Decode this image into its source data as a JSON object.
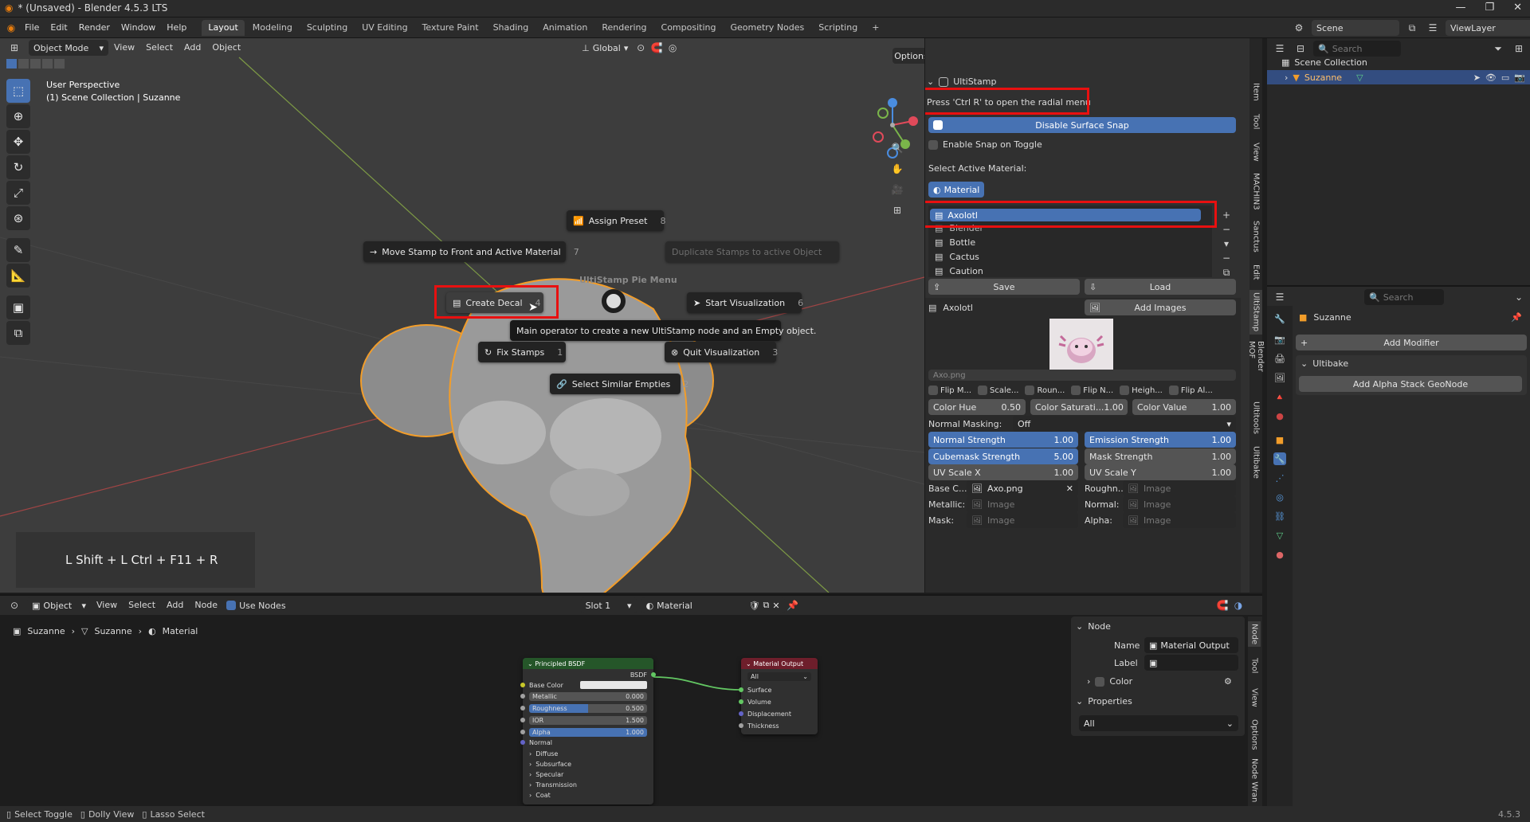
{
  "title": "* (Unsaved) - Blender 4.5.3 LTS",
  "menu": [
    "File",
    "Edit",
    "Render",
    "Window",
    "Help"
  ],
  "workspaces": [
    "Layout",
    "Modeling",
    "Sculpting",
    "UV Editing",
    "Texture Paint",
    "Shading",
    "Animation",
    "Rendering",
    "Compositing",
    "Geometry Nodes",
    "Scripting"
  ],
  "workspace_active": "Layout",
  "scene": "Scene",
  "view_layer": "ViewLayer",
  "viewport": {
    "mode": "Object Mode",
    "menus": [
      "View",
      "Select",
      "Add",
      "Object"
    ],
    "transform_orientation": "Global",
    "options_label": "Options",
    "overlay_line1": "User Perspective",
    "overlay_line2": "(1) Scene Collection | Suzanne",
    "shortcut_display": "L Shift + L Ctrl + F11 + R",
    "watermark": "UltiStamp Pie Menu",
    "tooltip": "Main operator to create a new UltiStamp node and an Empty object.",
    "pie": {
      "assign_preset": {
        "label": "Assign Preset",
        "num": "8"
      },
      "move_stamp": {
        "label": "Move Stamp to Front and Active Material",
        "num": "7"
      },
      "duplicate": {
        "label": "Duplicate Stamps to active Object",
        "num": ""
      },
      "create_decal": {
        "label": "Create Decal",
        "num": "4"
      },
      "start_vis": {
        "label": "Start Visualization",
        "num": "6"
      },
      "fix_stamps": {
        "label": "Fix Stamps",
        "num": "1"
      },
      "quit_vis": {
        "label": "Quit Visualization",
        "num": "3"
      },
      "select_similar": {
        "label": "Select Similar Empties",
        "num": "2"
      }
    }
  },
  "ultistamp": {
    "header": "UltiStamp",
    "hint": "Press 'Ctrl R' to open the radial menu",
    "disable_snap": "Disable Surface Snap",
    "enable_snap": "Enable Snap on Toggle",
    "select_material_label": "Select Active Material:",
    "material_btn": "Material",
    "stamps": [
      "Axolotl",
      "Blender",
      "Bottle",
      "Cactus",
      "Caution"
    ],
    "save": "Save",
    "load": "Load",
    "current": "Axolotl",
    "add_images": "Add Images",
    "image_name": "Axo.png",
    "flips": [
      "Flip M...",
      "Scale...",
      "Roun...",
      "Flip N...",
      "Heigh...",
      "Flip Al..."
    ],
    "color_hue": {
      "label": "Color Hue",
      "value": "0.50"
    },
    "color_sat": {
      "label": "Color Saturati...",
      "value": "1.00"
    },
    "color_val": {
      "label": "Color Value",
      "value": "1.00"
    },
    "normal_masking_label": "Normal Masking:",
    "normal_masking_value": "Off",
    "normal_strength": {
      "label": "Normal Strength",
      "value": "1.00"
    },
    "emission_strength": {
      "label": "Emission Strength",
      "value": "1.00"
    },
    "cubemask_strength": {
      "label": "Cubemask Strength",
      "value": "5.00"
    },
    "mask_strength": {
      "label": "Mask Strength",
      "value": "1.00"
    },
    "uv_scale_x": {
      "label": "UV Scale X",
      "value": "1.00"
    },
    "uv_scale_y": {
      "label": "UV Scale Y",
      "value": "1.00"
    },
    "base_color": {
      "label": "Base C...",
      "value": "Axo.png"
    },
    "roughness": {
      "label": "Roughn...",
      "value": "Image"
    },
    "metallic": {
      "label": "Metallic:",
      "value": "Image"
    },
    "normal": {
      "label": "Normal:",
      "value": "Image"
    },
    "mask": {
      "label": "Mask:",
      "value": "Image"
    },
    "alpha": {
      "label": "Alpha:",
      "value": "Image"
    }
  },
  "side_tabs": [
    "Item",
    "Tool",
    "View",
    "MACHIN3",
    "Sanctus",
    "Edit",
    "UltiStamp",
    "Blender MOF",
    "Ultitools",
    "Ultibake"
  ],
  "outliner": {
    "search": "Search",
    "collection": "Scene Collection",
    "object": "Suzanne"
  },
  "properties": {
    "search": "Search",
    "object": "Suzanne",
    "add_modifier": "Add Modifier",
    "ultibake": "Ultibake",
    "add_alpha": "Add Alpha Stack GeoNode"
  },
  "node_editor": {
    "type": "Object",
    "menus": [
      "View",
      "Select",
      "Add",
      "Node"
    ],
    "use_nodes": "Use Nodes",
    "slot": "Slot 1",
    "material": "Material",
    "breadcrumb": [
      "Suzanne",
      "Suzanne",
      "Material"
    ],
    "bsdf": {
      "title": "Principled BSDF",
      "out": "BSDF",
      "base_color": "Base Color",
      "metallic": {
        "label": "Metallic",
        "value": "0.000"
      },
      "roughness": {
        "label": "Roughness",
        "value": "0.500"
      },
      "ior": {
        "label": "IOR",
        "value": "1.500"
      },
      "alpha": {
        "label": "Alpha",
        "value": "1.000"
      },
      "normal": "Normal",
      "subs": [
        "Diffuse",
        "Subsurface",
        "Specular",
        "Transmission",
        "Coat"
      ]
    },
    "output": {
      "title": "Material Output",
      "target": "All",
      "inputs": [
        "Surface",
        "Volume",
        "Displacement",
        "Thickness"
      ]
    },
    "side": {
      "node_header": "Node",
      "name_label": "Name",
      "name_value": "Material Output",
      "label_label": "Label",
      "color": "Color",
      "properties": "Properties",
      "prop_value": "All"
    },
    "side_tabs": [
      "Node",
      "Tool",
      "View",
      "Options",
      "Node Wran"
    ]
  },
  "status": {
    "items": [
      "Select Toggle",
      "Dolly View",
      "Lasso Select"
    ],
    "version": "4.5.3"
  },
  "colors": {
    "accent": "#4772b3",
    "red_highlight": "#e81010",
    "selection": "#f5a623"
  }
}
